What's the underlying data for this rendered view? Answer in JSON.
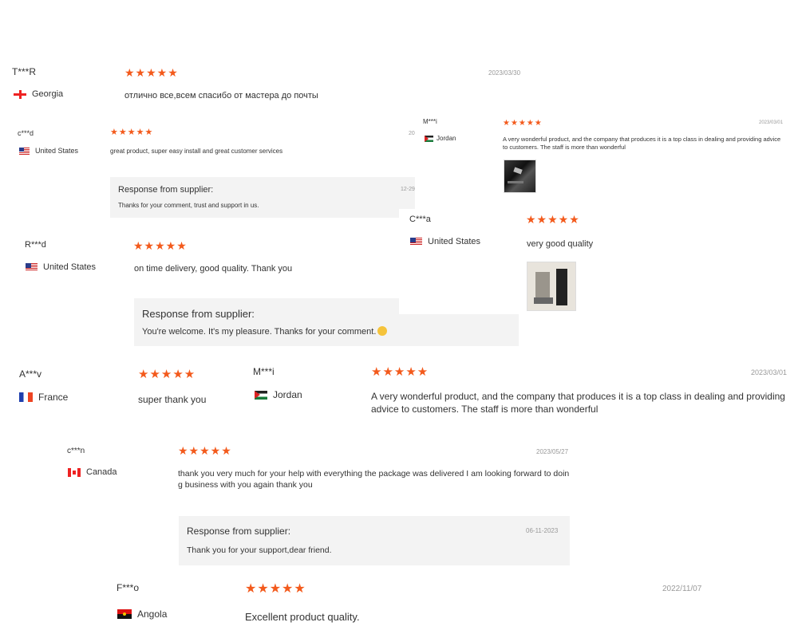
{
  "reviews": [
    {
      "name": "T***R",
      "country": "Georgia",
      "text": "отлично все,всем спасибо от мастера до почты",
      "date": "2023/03/30",
      "stars": "★★★★★"
    },
    {
      "name": "c***d",
      "country": "United States",
      "text": "great product, super easy install and great customer services",
      "date": "20",
      "stars": "★★★★★",
      "response": {
        "title": "Response from supplier:",
        "text": "Thanks for your comment, trust and support in us.",
        "date": "12-29"
      }
    },
    {
      "name": "M***i",
      "country": "Jordan",
      "text": "A very wonderful product, and the company that produces it is a top class in dealing and providing advice to customers. The staff is more than wonderful",
      "date": "2023/03/01",
      "stars": "★★★★★",
      "image": "product-photo"
    },
    {
      "name": "C***a",
      "country": "United States",
      "text": "very good quality",
      "stars": "★★★★★",
      "image": "product-photo"
    },
    {
      "name": "R***d",
      "country": "United States",
      "text": "on time delivery, good quality. Thank you",
      "stars": "★★★★★",
      "response": {
        "title": "Response from supplier:",
        "text": "You're welcome. It's my pleasure. Thanks for your comment."
      }
    },
    {
      "name": "A***v",
      "country": "France",
      "text": "super thank you",
      "stars": "★★★★★"
    },
    {
      "name": "M***i",
      "country": "Jordan",
      "text": "A very wonderful product, and the company that produces it is a top class in dealing and providing advice to customers. The staff is more than wonderful",
      "date": "2023/03/01",
      "stars": "★★★★★"
    },
    {
      "name": "c***n",
      "country": "Canada",
      "text": "thank you very much for your help with everything the package was delivered I am looking forward to doing business with you again thank you",
      "date": "2023/05/27",
      "stars": "★★★★★",
      "response": {
        "title": "Response from supplier:",
        "text": "Thank you for your support,dear friend.",
        "date": "06-11-2023"
      }
    },
    {
      "name": "F***o",
      "country": "Angola",
      "text": "Excellent product quality.",
      "date": "2022/11/07",
      "stars": "★★★★★"
    }
  ],
  "colors": {
    "star": "#f35a1c",
    "response_bg": "#f3f3f3",
    "date": "#999999"
  }
}
